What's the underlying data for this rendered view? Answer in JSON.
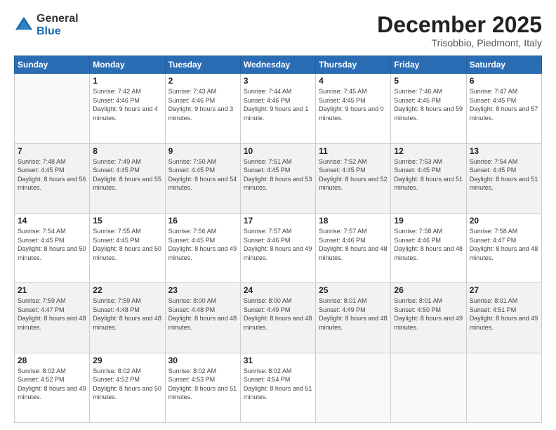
{
  "header": {
    "logo_general": "General",
    "logo_blue": "Blue",
    "month": "December 2025",
    "location": "Trisobbio, Piedmont, Italy"
  },
  "weekdays": [
    "Sunday",
    "Monday",
    "Tuesday",
    "Wednesday",
    "Thursday",
    "Friday",
    "Saturday"
  ],
  "weeks": [
    [
      {
        "day": "",
        "sunrise": "",
        "sunset": "",
        "daylight": ""
      },
      {
        "day": "1",
        "sunrise": "Sunrise: 7:42 AM",
        "sunset": "Sunset: 4:46 PM",
        "daylight": "Daylight: 9 hours and 4 minutes."
      },
      {
        "day": "2",
        "sunrise": "Sunrise: 7:43 AM",
        "sunset": "Sunset: 4:46 PM",
        "daylight": "Daylight: 9 hours and 3 minutes."
      },
      {
        "day": "3",
        "sunrise": "Sunrise: 7:44 AM",
        "sunset": "Sunset: 4:46 PM",
        "daylight": "Daylight: 9 hours and 1 minute."
      },
      {
        "day": "4",
        "sunrise": "Sunrise: 7:45 AM",
        "sunset": "Sunset: 4:45 PM",
        "daylight": "Daylight: 9 hours and 0 minutes."
      },
      {
        "day": "5",
        "sunrise": "Sunrise: 7:46 AM",
        "sunset": "Sunset: 4:45 PM",
        "daylight": "Daylight: 8 hours and 59 minutes."
      },
      {
        "day": "6",
        "sunrise": "Sunrise: 7:47 AM",
        "sunset": "Sunset: 4:45 PM",
        "daylight": "Daylight: 8 hours and 57 minutes."
      }
    ],
    [
      {
        "day": "7",
        "sunrise": "Sunrise: 7:48 AM",
        "sunset": "Sunset: 4:45 PM",
        "daylight": "Daylight: 8 hours and 56 minutes."
      },
      {
        "day": "8",
        "sunrise": "Sunrise: 7:49 AM",
        "sunset": "Sunset: 4:45 PM",
        "daylight": "Daylight: 8 hours and 55 minutes."
      },
      {
        "day": "9",
        "sunrise": "Sunrise: 7:50 AM",
        "sunset": "Sunset: 4:45 PM",
        "daylight": "Daylight: 8 hours and 54 minutes."
      },
      {
        "day": "10",
        "sunrise": "Sunrise: 7:51 AM",
        "sunset": "Sunset: 4:45 PM",
        "daylight": "Daylight: 8 hours and 53 minutes."
      },
      {
        "day": "11",
        "sunrise": "Sunrise: 7:52 AM",
        "sunset": "Sunset: 4:45 PM",
        "daylight": "Daylight: 8 hours and 52 minutes."
      },
      {
        "day": "12",
        "sunrise": "Sunrise: 7:53 AM",
        "sunset": "Sunset: 4:45 PM",
        "daylight": "Daylight: 8 hours and 51 minutes."
      },
      {
        "day": "13",
        "sunrise": "Sunrise: 7:54 AM",
        "sunset": "Sunset: 4:45 PM",
        "daylight": "Daylight: 8 hours and 51 minutes."
      }
    ],
    [
      {
        "day": "14",
        "sunrise": "Sunrise: 7:54 AM",
        "sunset": "Sunset: 4:45 PM",
        "daylight": "Daylight: 8 hours and 50 minutes."
      },
      {
        "day": "15",
        "sunrise": "Sunrise: 7:55 AM",
        "sunset": "Sunset: 4:45 PM",
        "daylight": "Daylight: 8 hours and 50 minutes."
      },
      {
        "day": "16",
        "sunrise": "Sunrise: 7:56 AM",
        "sunset": "Sunset: 4:45 PM",
        "daylight": "Daylight: 8 hours and 49 minutes."
      },
      {
        "day": "17",
        "sunrise": "Sunrise: 7:57 AM",
        "sunset": "Sunset: 4:46 PM",
        "daylight": "Daylight: 8 hours and 49 minutes."
      },
      {
        "day": "18",
        "sunrise": "Sunrise: 7:57 AM",
        "sunset": "Sunset: 4:46 PM",
        "daylight": "Daylight: 8 hours and 48 minutes."
      },
      {
        "day": "19",
        "sunrise": "Sunrise: 7:58 AM",
        "sunset": "Sunset: 4:46 PM",
        "daylight": "Daylight: 8 hours and 48 minutes."
      },
      {
        "day": "20",
        "sunrise": "Sunrise: 7:58 AM",
        "sunset": "Sunset: 4:47 PM",
        "daylight": "Daylight: 8 hours and 48 minutes."
      }
    ],
    [
      {
        "day": "21",
        "sunrise": "Sunrise: 7:59 AM",
        "sunset": "Sunset: 4:47 PM",
        "daylight": "Daylight: 8 hours and 48 minutes."
      },
      {
        "day": "22",
        "sunrise": "Sunrise: 7:59 AM",
        "sunset": "Sunset: 4:48 PM",
        "daylight": "Daylight: 8 hours and 48 minutes."
      },
      {
        "day": "23",
        "sunrise": "Sunrise: 8:00 AM",
        "sunset": "Sunset: 4:48 PM",
        "daylight": "Daylight: 8 hours and 48 minutes."
      },
      {
        "day": "24",
        "sunrise": "Sunrise: 8:00 AM",
        "sunset": "Sunset: 4:49 PM",
        "daylight": "Daylight: 8 hours and 48 minutes."
      },
      {
        "day": "25",
        "sunrise": "Sunrise: 8:01 AM",
        "sunset": "Sunset: 4:49 PM",
        "daylight": "Daylight: 8 hours and 48 minutes."
      },
      {
        "day": "26",
        "sunrise": "Sunrise: 8:01 AM",
        "sunset": "Sunset: 4:50 PM",
        "daylight": "Daylight: 8 hours and 49 minutes."
      },
      {
        "day": "27",
        "sunrise": "Sunrise: 8:01 AM",
        "sunset": "Sunset: 4:51 PM",
        "daylight": "Daylight: 8 hours and 49 minutes."
      }
    ],
    [
      {
        "day": "28",
        "sunrise": "Sunrise: 8:02 AM",
        "sunset": "Sunset: 4:52 PM",
        "daylight": "Daylight: 8 hours and 49 minutes."
      },
      {
        "day": "29",
        "sunrise": "Sunrise: 8:02 AM",
        "sunset": "Sunset: 4:52 PM",
        "daylight": "Daylight: 8 hours and 50 minutes."
      },
      {
        "day": "30",
        "sunrise": "Sunrise: 8:02 AM",
        "sunset": "Sunset: 4:53 PM",
        "daylight": "Daylight: 8 hours and 51 minutes."
      },
      {
        "day": "31",
        "sunrise": "Sunrise: 8:02 AM",
        "sunset": "Sunset: 4:54 PM",
        "daylight": "Daylight: 8 hours and 51 minutes."
      },
      {
        "day": "",
        "sunrise": "",
        "sunset": "",
        "daylight": ""
      },
      {
        "day": "",
        "sunrise": "",
        "sunset": "",
        "daylight": ""
      },
      {
        "day": "",
        "sunrise": "",
        "sunset": "",
        "daylight": ""
      }
    ]
  ],
  "row_shading": [
    false,
    true,
    false,
    true,
    false
  ]
}
